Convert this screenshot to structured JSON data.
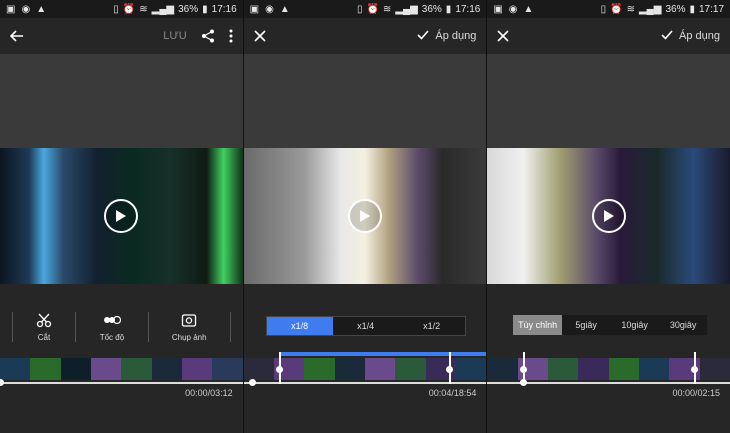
{
  "status_bar": {
    "battery": "36%"
  },
  "screens": [
    {
      "status_time": "17:16",
      "toolbar": {
        "save_label": "LƯU"
      },
      "tools": [
        {
          "icon": "scissors-icon",
          "label": "Cắt"
        },
        {
          "icon": "speed-icon",
          "label": "Tốc độ"
        },
        {
          "icon": "camera-icon",
          "label": "Chụp ảnh"
        }
      ],
      "time": "00:00/03:12"
    },
    {
      "status_time": "17:16",
      "toolbar": {
        "apply_label": "Áp dụng"
      },
      "speed_options": [
        "x1/8",
        "x1/4",
        "x1/2"
      ],
      "selected_speed": "x1/8",
      "time": "00:04/18:54"
    },
    {
      "status_time": "17:17",
      "toolbar": {
        "apply_label": "Áp dụng"
      },
      "duration_options": [
        "Tùy chỉnh",
        "5giây",
        "10giây",
        "30giây"
      ],
      "selected_duration": "Tùy chỉnh",
      "time": "00:00/02:15"
    }
  ]
}
